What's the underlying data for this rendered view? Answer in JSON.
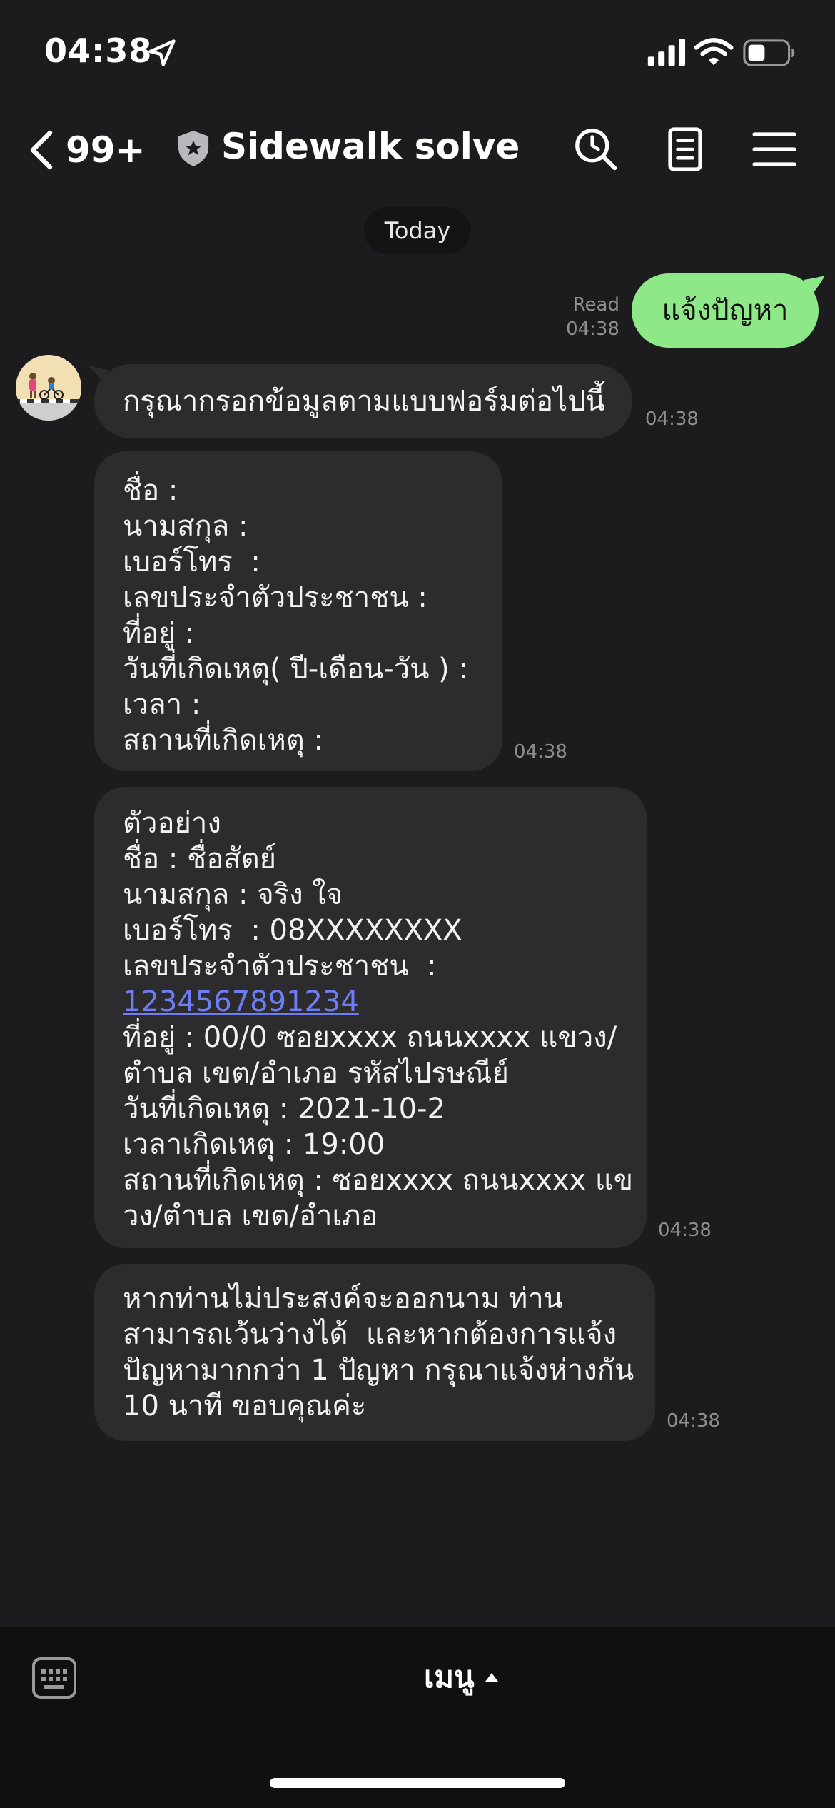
{
  "status_bar": {
    "time": "04:38",
    "icons": [
      "location-arrow-icon",
      "cellular-signal-icon",
      "wifi-icon",
      "battery-icon"
    ]
  },
  "header": {
    "back_count": "99+",
    "title": "Sidewalk solve",
    "icons": [
      "back-chevron-icon",
      "shield-icon",
      "search-icon",
      "notes-icon",
      "menu-icon"
    ]
  },
  "date_divider": "Today",
  "outgoing": {
    "text": "แจ้งปัญหา",
    "read_label": "Read",
    "time": "04:38",
    "bubble_color": "#8ee887"
  },
  "incoming": [
    {
      "lines": [
        "กรุณากรอกข้อมูลตามแบบฟอร์มต่อไปนี้"
      ],
      "time": "04:38"
    },
    {
      "lines": [
        "ชื่อ :",
        "นามสกุล :",
        "เบอร์โทร  :",
        "เลขประจำตัวประชาชน :",
        "ที่อยู่ :",
        "วันที่เกิดเหตุ( ปี-เดือน-วัน ) :",
        "เวลา :",
        "สถานที่เกิดเหตุ :"
      ],
      "time": "04:38"
    },
    {
      "lines": [
        "ตัวอย่าง",
        "ชื่อ : ชื่อสัตย์",
        "นามสกุล : จริง ใจ",
        "เบอร์โทร  : 08XXXXXXXX",
        "เลขประจำตัวประชาชน  :",
        "1234567891234",
        "ที่อยู่ : 00/0 ซอยxxxx ถนนxxxx แขวง/",
        "ตำบล เขต/อำเภอ รหัสไปรษณีย์",
        "วันที่เกิดเหตุ : 2021-10-2",
        "เวลาเกิดเหตุ : 19:00",
        "สถานที่เกิดเหตุ : ซอยxxxx ถนนxxxx แข",
        "วง/ตำบล เขต/อำเภอ"
      ],
      "time": "04:38"
    },
    {
      "lines": [
        "หากท่านไม่ประสงค์จะออกนาม ท่าน",
        "สามารถเว้นว่างได้  และหากต้องการแจ้ง",
        "ปัญหามากกว่า 1 ปัญหา กรุณาแจ้งห่างกัน",
        "10 นาที ขอบคุณค่ะ"
      ],
      "time": "04:38"
    }
  ],
  "bottom_bar": {
    "menu_label": "เมนู",
    "icons": [
      "keyboard-icon",
      "caret-up-icon"
    ]
  },
  "colors": {
    "background": "#1c1c1e",
    "incoming_bubble": "#2c2c2e",
    "link": "#6f7df5",
    "timestamp": "#8e8e93"
  }
}
